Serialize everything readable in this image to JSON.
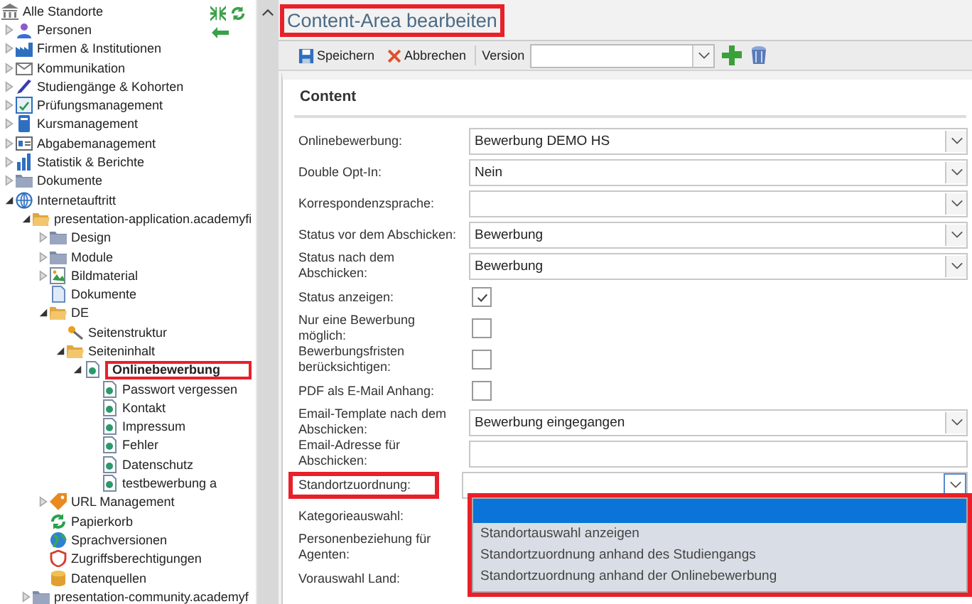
{
  "sidebar": {
    "root": {
      "label": "Alle Standorte"
    },
    "items": [
      {
        "label": "Personen",
        "kind": "person",
        "expanded": false,
        "selected": false
      },
      {
        "label": "Firmen & Institutionen",
        "kind": "factory",
        "expanded": false,
        "selected": false
      },
      {
        "label": "Kommunikation",
        "kind": "mail",
        "expanded": false,
        "selected": false
      },
      {
        "label": "Studiengänge & Kohorten",
        "kind": "pen",
        "expanded": false,
        "selected": false
      },
      {
        "label": "Prüfungsmanagement",
        "kind": "form",
        "expanded": false,
        "selected": false
      },
      {
        "label": "Kursmanagement",
        "kind": "book",
        "expanded": false,
        "selected": false
      },
      {
        "label": "Abgabemanagement",
        "kind": "card",
        "expanded": false,
        "selected": false
      },
      {
        "label": "Statistik & Berichte",
        "kind": "chart",
        "expanded": false,
        "selected": false
      },
      {
        "label": "Dokumente",
        "kind": "folder",
        "expanded": false,
        "selected": false
      },
      {
        "label": "Internetauftritt",
        "kind": "globe",
        "expanded": true,
        "selected": false,
        "children": [
          {
            "label": "presentation-application.academyfi",
            "kind": "openfolder",
            "expanded": true,
            "selected": false,
            "children": [
              {
                "label": "Design",
                "kind": "folder",
                "expanded": false,
                "selected": false
              },
              {
                "label": "Module",
                "kind": "folder",
                "expanded": false,
                "selected": false
              },
              {
                "label": "Bildmaterial",
                "kind": "image",
                "expanded": false,
                "selected": false
              },
              {
                "label": "Dokumente",
                "kind": "doc",
                "selected": false
              },
              {
                "label": "DE",
                "kind": "openfolder",
                "expanded": true,
                "selected": false,
                "children": [
                  {
                    "label": "Seitenstruktur",
                    "kind": "key",
                    "selected": false
                  },
                  {
                    "label": "Seiteninhalt",
                    "kind": "openfolder",
                    "expanded": true,
                    "selected": false,
                    "children": [
                      {
                        "label": "Onlinebewerbung",
                        "kind": "page",
                        "expanded": true,
                        "selected": true,
                        "highlighted": true,
                        "children": [
                          {
                            "label": "Passwort vergessen",
                            "kind": "page",
                            "selected": false
                          },
                          {
                            "label": "Kontakt",
                            "kind": "page",
                            "selected": false
                          },
                          {
                            "label": "Impressum",
                            "kind": "page",
                            "selected": false
                          },
                          {
                            "label": "Fehler",
                            "kind": "page",
                            "selected": false
                          },
                          {
                            "label": "Datenschutz",
                            "kind": "page",
                            "selected": false
                          },
                          {
                            "label": "testbewerbung a",
                            "kind": "page",
                            "selected": false
                          }
                        ]
                      }
                    ]
                  }
                ]
              },
              {
                "label": "URL Management",
                "kind": "tag",
                "expanded": false,
                "selected": false
              },
              {
                "label": "Papierkorb",
                "kind": "recycle",
                "selected": false
              },
              {
                "label": "Sprachversionen",
                "kind": "earth",
                "selected": false
              },
              {
                "label": "Zugriffsberechtigungen",
                "kind": "shield",
                "selected": false
              },
              {
                "label": "Datenquellen",
                "kind": "db",
                "selected": false
              }
            ]
          },
          {
            "label": "presentation-community.academyf",
            "kind": "folder",
            "expanded": false,
            "selected": false
          }
        ]
      }
    ]
  },
  "title": {
    "text": "Content-Area bearbeiten",
    "highlighted": true
  },
  "toolbar": {
    "save": "Speichern",
    "cancel": "Abbrechen",
    "version_label": "Version"
  },
  "section": "Content",
  "fields": [
    {
      "label": "Onlinebewerbung:",
      "kind": "select",
      "value": "Bewerbung DEMO HS"
    },
    {
      "label": "Double Opt-In:",
      "kind": "select",
      "value": "Nein"
    },
    {
      "label": "Korrespondenzsprache:",
      "kind": "select"
    },
    {
      "label": "Status vor dem Abschicken:",
      "kind": "select",
      "value": "Bewerbung"
    },
    {
      "label": "Status nach dem Abschicken:",
      "kind": "select",
      "value": "Bewerbung"
    },
    {
      "label": "Status anzeigen:",
      "kind": "checkbox",
      "checked": true
    },
    {
      "label": "Nur eine Bewerbung möglich:",
      "kind": "checkbox",
      "checked": false
    },
    {
      "label": "Bewerbungsfristen berücksichtigen:",
      "kind": "checkbox",
      "checked": false
    },
    {
      "label": "PDF als E-Mail Anhang:",
      "kind": "checkbox",
      "checked": false
    },
    {
      "label": "Email-Template nach dem Abschicken:",
      "kind": "select",
      "value": "Bewerbung eingegangen"
    },
    {
      "label": "Email-Adresse für Abschicken:",
      "kind": "text"
    },
    {
      "label": "Standortzuordnung:",
      "kind": "select",
      "highlighted": true,
      "expanded": true,
      "options": [
        {
          "selected": true
        },
        {
          "label": "Standortauswahl anzeigen",
          "selected": false
        },
        {
          "label": "Standortzuordnung anhand des Studiengangs",
          "selected": false
        },
        {
          "label": "Standortzuordnung anhand der Onlinebewerbung",
          "selected": false
        }
      ]
    },
    {
      "label": "Kategorieauswahl:",
      "kind": "hidden"
    },
    {
      "label": "Personenbeziehung für Agenten:",
      "kind": "hidden"
    },
    {
      "label": "Vorauswahl Land:",
      "kind": "hidden"
    }
  ]
}
